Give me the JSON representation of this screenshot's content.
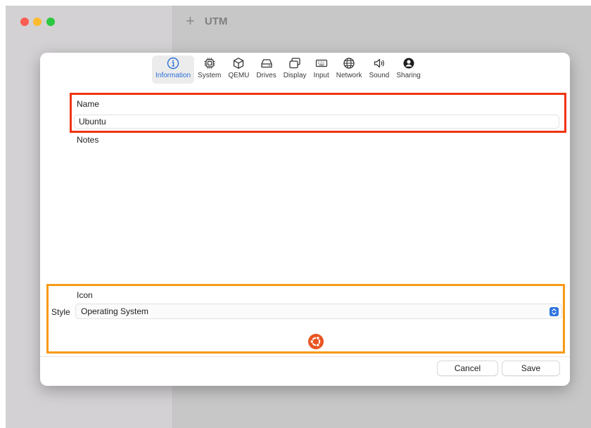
{
  "app": {
    "title": "UTM",
    "new_button_glyph": "+"
  },
  "tabs": [
    {
      "label": "Information",
      "icon": "info-icon",
      "active": true
    },
    {
      "label": "System",
      "icon": "cpu-icon",
      "active": false
    },
    {
      "label": "QEMU",
      "icon": "cube-icon",
      "active": false
    },
    {
      "label": "Drives",
      "icon": "drive-icon",
      "active": false
    },
    {
      "label": "Display",
      "icon": "display-icon",
      "active": false
    },
    {
      "label": "Input",
      "icon": "keyboard-icon",
      "active": false
    },
    {
      "label": "Network",
      "icon": "globe-icon",
      "active": false
    },
    {
      "label": "Sound",
      "icon": "speaker-icon",
      "active": false
    },
    {
      "label": "Sharing",
      "icon": "person-icon",
      "active": false
    }
  ],
  "info": {
    "name_label": "Name",
    "name_value": "Ubuntu",
    "notes_label": "Notes",
    "notes_value": "",
    "icon_label": "Icon",
    "style_label": "Style",
    "style_value": "Operating System",
    "icon_selected": "ubuntu-logo-icon"
  },
  "buttons": {
    "cancel": "Cancel",
    "save": "Save"
  },
  "colors": {
    "accent": "#2f73e0",
    "highlight_name": "#f03412",
    "highlight_icon": "#f79a14",
    "ubuntu": "#e95420"
  }
}
